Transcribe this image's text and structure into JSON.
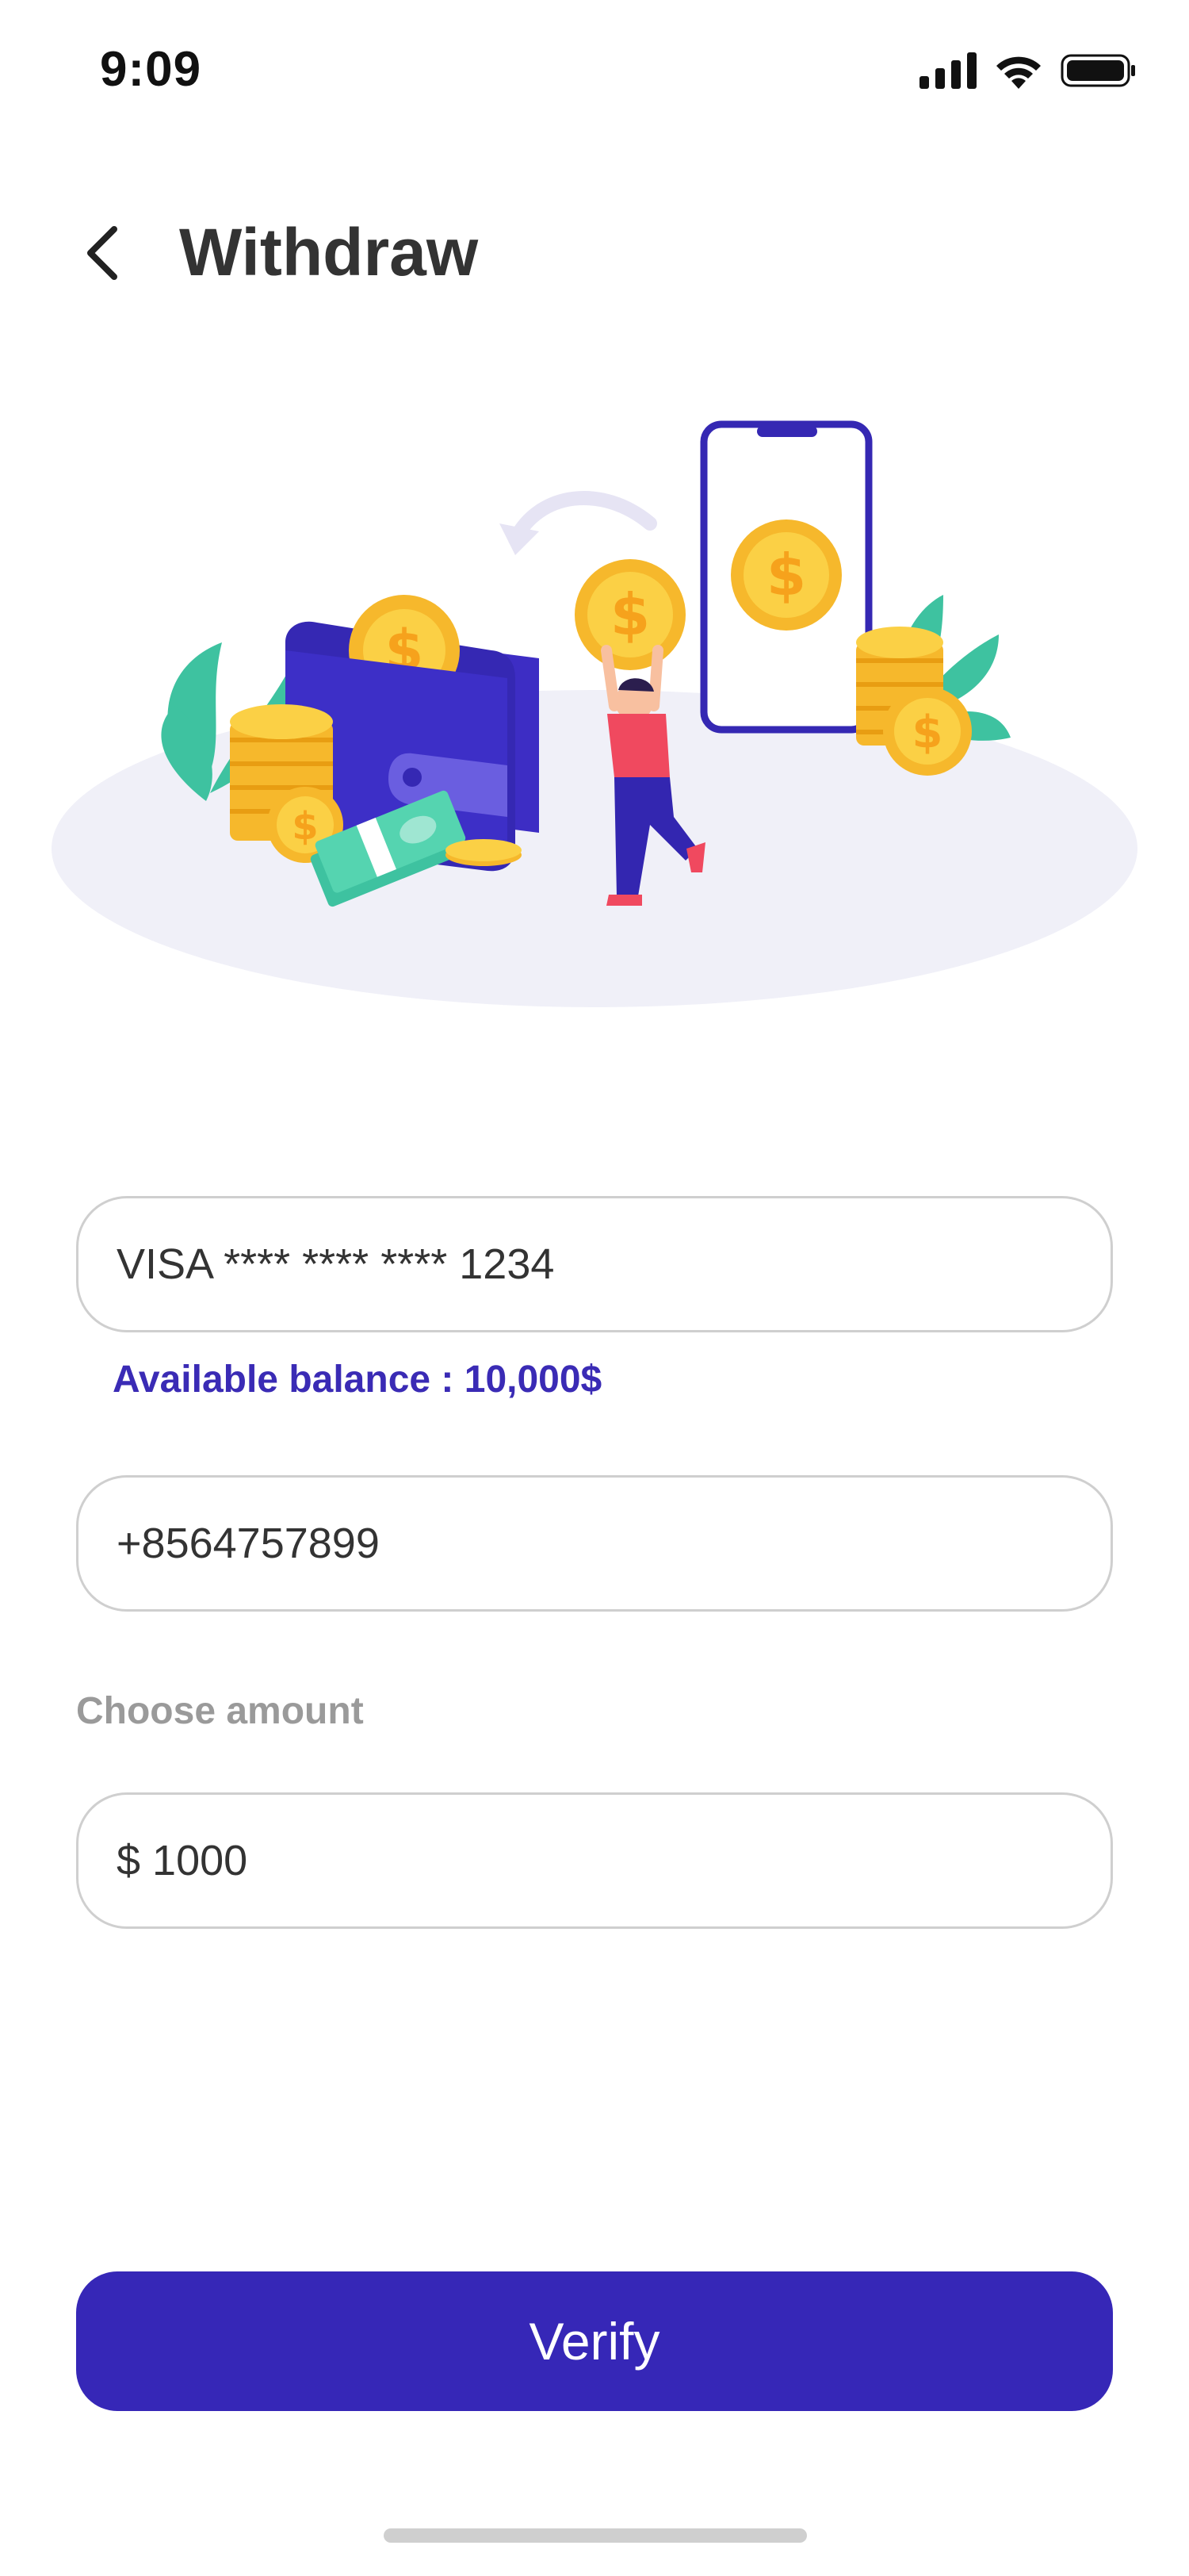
{
  "status_bar": {
    "time": "9:09"
  },
  "header": {
    "title": "Withdraw"
  },
  "form": {
    "card": {
      "value": "VISA **** **** **** 1234"
    },
    "balance_text": "Available balance : 10,000$",
    "phone": {
      "value": "+8564757899"
    },
    "amount_label": "Choose amount",
    "amount": {
      "value": "$ 1000"
    }
  },
  "actions": {
    "verify_label": "Verify"
  },
  "colors": {
    "primary": "#3627b7",
    "balance_text": "#3a2bb5",
    "muted_label": "#9a9a9a",
    "field_border": "#cfcfcf"
  },
  "icons": [
    "signal-icon",
    "wifi-icon",
    "battery-icon",
    "back-arrow-icon"
  ]
}
